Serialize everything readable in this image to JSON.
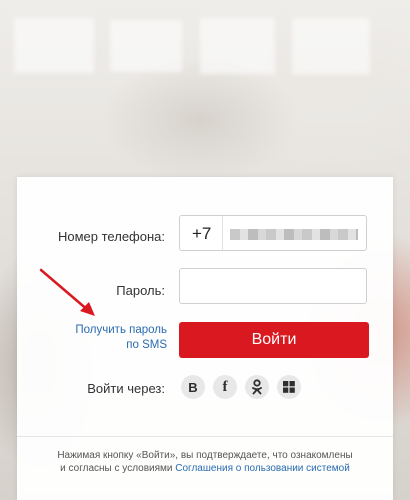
{
  "form": {
    "phone_label": "Номер телефона:",
    "phone_prefix": "+7",
    "password_label": "Пароль:",
    "password_value": "",
    "sms_link_line1": "Получить пароль",
    "sms_link_line2": "по SMS",
    "login_button": "Войти",
    "login_via_label": "Войти через:"
  },
  "social": [
    {
      "name": "vk",
      "glyph": "B"
    },
    {
      "name": "facebook",
      "glyph": "f"
    },
    {
      "name": "odnoklassniki",
      "glyph": "ok"
    },
    {
      "name": "windows",
      "glyph": "windows"
    }
  ],
  "legal": {
    "text_part1": "Нажимая кнопку «Войти», вы подтверждаете, что ознакомлены",
    "text_part2": "и согласны с условиями",
    "link": "Соглашения о пользовании системой"
  },
  "colors": {
    "accent": "#d9191f",
    "link": "#2a6cb0",
    "annotation_arrow": "#d9191f"
  }
}
